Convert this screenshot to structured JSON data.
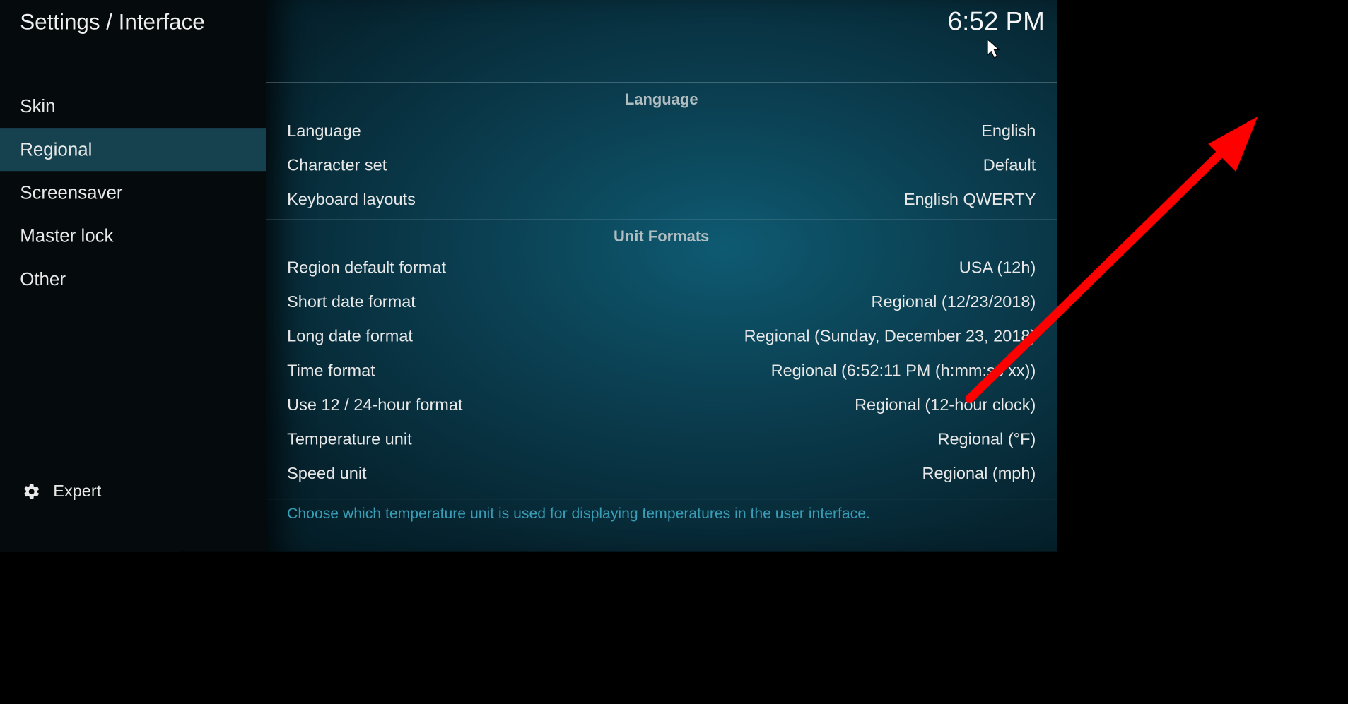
{
  "header": {
    "breadcrumb": "Settings / Interface",
    "clock": "6:52 PM"
  },
  "sidebar": {
    "items": [
      {
        "label": "Skin",
        "active": false
      },
      {
        "label": "Regional",
        "active": true
      },
      {
        "label": "Screensaver",
        "active": false
      },
      {
        "label": "Master lock",
        "active": false
      },
      {
        "label": "Other",
        "active": false
      }
    ],
    "level_label": "Expert",
    "level_icon": "gear-icon"
  },
  "groups": [
    {
      "title": "Language",
      "rows": [
        {
          "label": "Language",
          "value": "English"
        },
        {
          "label": "Character set",
          "value": "Default"
        },
        {
          "label": "Keyboard layouts",
          "value": "English QWERTY"
        }
      ]
    },
    {
      "title": "Unit Formats",
      "rows": [
        {
          "label": "Region default format",
          "value": "USA (12h)"
        },
        {
          "label": "Short date format",
          "value": "Regional (12/23/2018)"
        },
        {
          "label": "Long date format",
          "value": "Regional (Sunday, December 23, 2018)"
        },
        {
          "label": "Time format",
          "value": "Regional (6:52:11 PM (h:mm:ss xx))"
        },
        {
          "label": "Use 12 / 24-hour format",
          "value": "Regional (12-hour clock)"
        },
        {
          "label": "Temperature unit",
          "value": "Regional (°F)"
        },
        {
          "label": "Speed unit",
          "value": "Regional (mph)"
        }
      ]
    }
  ],
  "help_text": "Choose which temperature unit is used for displaying temperatures in the user interface.",
  "colors": {
    "accent": "#16414e",
    "annotation": "#ff0000",
    "help": "#3a9db6"
  },
  "annotation": {
    "type": "arrow",
    "points_to": "Language value (English)"
  }
}
